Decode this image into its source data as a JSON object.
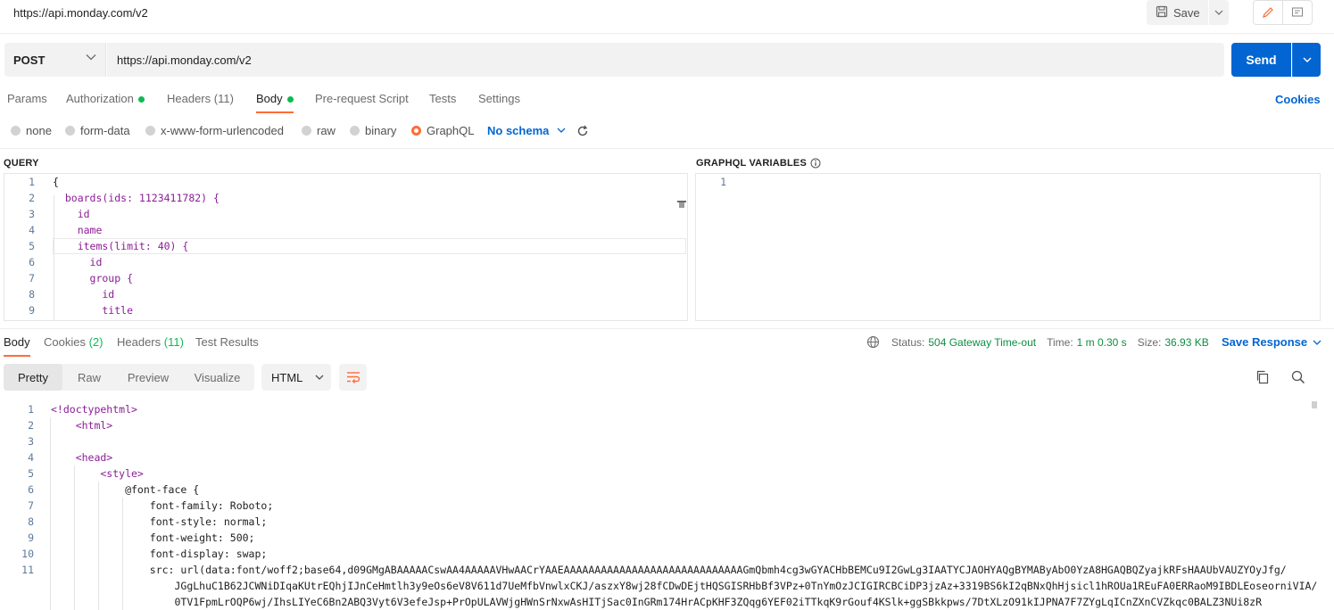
{
  "header": {
    "title": "https://api.monday.com/v2",
    "save_label": "Save"
  },
  "request": {
    "method": "POST",
    "url": "https://api.monday.com/v2",
    "send_label": "Send",
    "tabs": [
      {
        "label": "Params"
      },
      {
        "label": "Authorization"
      },
      {
        "label": "Headers (11)"
      },
      {
        "label": "Body"
      },
      {
        "label": "Pre-request Script"
      },
      {
        "label": "Tests"
      },
      {
        "label": "Settings"
      }
    ],
    "cookies_label": "Cookies",
    "body_modes": [
      "none",
      "form-data",
      "x-www-form-urlencoded",
      "raw",
      "binary",
      "GraphQL"
    ],
    "schema_label": "No schema"
  },
  "query": {
    "label": "QUERY",
    "lines": [
      {
        "n": "1",
        "text": "{"
      },
      {
        "n": "2",
        "text": "  boards(ids: 1123411782) {"
      },
      {
        "n": "3",
        "text": "    id"
      },
      {
        "n": "4",
        "text": "    name"
      },
      {
        "n": "5",
        "text": "    items(limit: 40) {"
      },
      {
        "n": "6",
        "text": "      id"
      },
      {
        "n": "7",
        "text": "      group {"
      },
      {
        "n": "8",
        "text": "        id"
      },
      {
        "n": "9",
        "text": "        title"
      }
    ]
  },
  "variables": {
    "label": "GRAPHQL VARIABLES",
    "lines": [
      {
        "n": "1",
        "text": ""
      }
    ]
  },
  "response": {
    "tabs": [
      {
        "label": "Body"
      },
      {
        "label": "Cookies",
        "count": "(2)"
      },
      {
        "label": "Headers",
        "count": "(11)"
      },
      {
        "label": "Test Results"
      }
    ],
    "status_label": "Status:",
    "status_value": "504 Gateway Time-out",
    "time_label": "Time:",
    "time_value": "1 m 0.30 s",
    "size_label": "Size:",
    "size_value": "36.93 KB",
    "save_label": "Save Response",
    "views": [
      "Pretty",
      "Raw",
      "Preview",
      "Visualize"
    ],
    "format": "HTML",
    "lines": [
      {
        "n": "1",
        "text": "<!doctypehtml>"
      },
      {
        "n": "2",
        "text": "    <html>"
      },
      {
        "n": "3",
        "text": ""
      },
      {
        "n": "4",
        "text": "    <head>"
      },
      {
        "n": "5",
        "text": "        <style>"
      },
      {
        "n": "6",
        "text": "            @font-face {"
      },
      {
        "n": "7",
        "text": "                font-family: Roboto;"
      },
      {
        "n": "8",
        "text": "                font-style: normal;"
      },
      {
        "n": "9",
        "text": "                font-weight: 500;"
      },
      {
        "n": "10",
        "text": "                font-display: swap;"
      },
      {
        "n": "11",
        "text": "                src: url(data:font/woff2;base64,d09GMgABAAAAACswAA4AAAAAVHwAACrYAAEAAAAAAAAAAAAAAAAAAAAAAAAAAAAAGmQbmh4cg3wGYACHbBEMCu9I2GwLg3IAATYCJAOHYAQgBYMAByAbO0YzA8HGAQBQZyajkRFsHAAUbVAUZYOyJfg/"
      },
      {
        "n": "",
        "text": "                    JGgLhuC1B62JCWNiDIqaKUtrEQhjIJnCeHmtlh3y9eOs6eV8V611d7UeMfbVnwlxCKJ/aszxY8wj28fCDwDEjtHQSGISRHbBf3VPz+0TnYmOzJCIGIRCBCiDP3jzAz+3319BS6kI2qBNxQhHjsicl1hROUa1REuFA0ERRaoM9IBDLEoseorniVIA/"
      },
      {
        "n": "",
        "text": "                    0TV1FpmLrOQP6wj/IhsLIYeC6Bn2ABQ3Vyt6V3efeJsp+PrOpULAVWjgHWnSrNxwAsHITjSac0InGRm174HrACpKHF3ZQqg6YEF02iTTkqK9rGouf4KSlk+ggSBkkpws/7DtXLzO91kIJPNA7F7ZYgLqICnZXnCVZkqc0BALZ3NUi8zR"
      }
    ]
  }
}
